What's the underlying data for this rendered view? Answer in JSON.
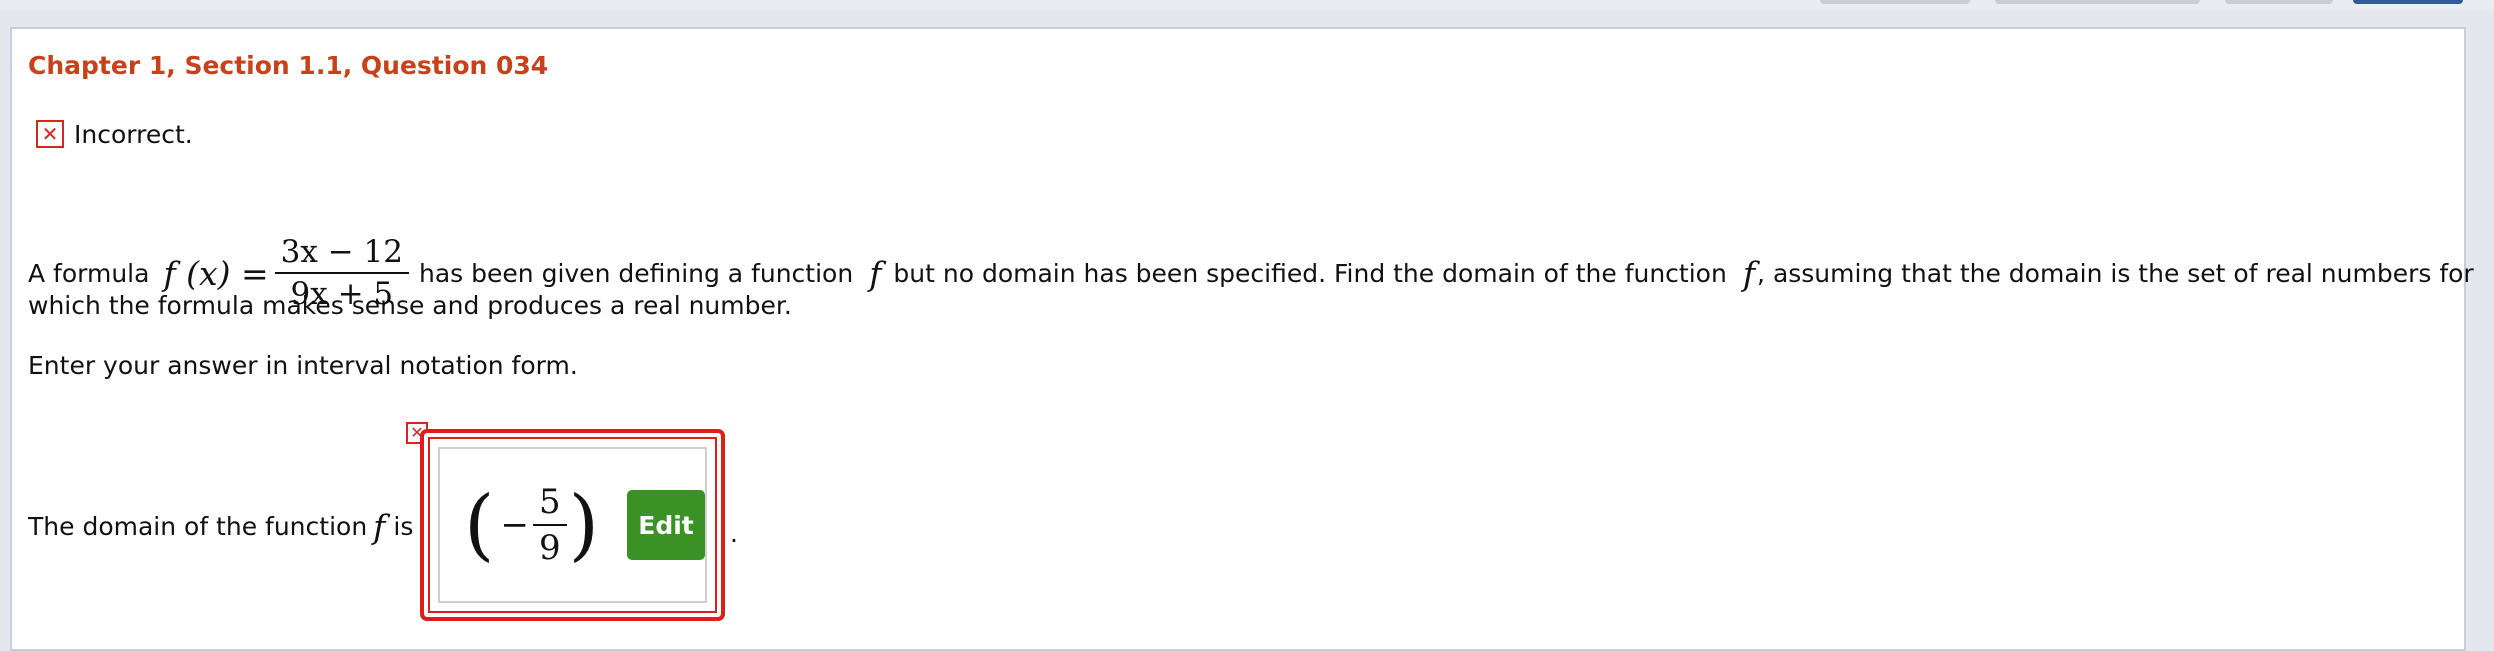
{
  "header": {
    "title": "Chapter 1, Section 1.1, Question 034"
  },
  "feedback": {
    "icon": "x-mark-icon",
    "status_text": "Incorrect."
  },
  "question": {
    "intro": "A formula",
    "function_lhs": "f (x) =",
    "numerator": "3x − 12",
    "denominator": "9x + 5",
    "text_middle": "has been given defining a function",
    "f_symbol": "f",
    "text_after_f": "but no domain has been specified. Find the domain of the function",
    "f_symbol2": "f",
    "text_end": ", assuming that the domain is the set of real numbers for",
    "line2": "which the formula makes sense and produces a real number.",
    "instructions": "Enter your answer in interval notation form."
  },
  "answer": {
    "label_prefix": "The domain of the function",
    "label_f": "f",
    "label_suffix": "is",
    "left_paren": "(",
    "sign": "−",
    "numerator": "5",
    "denominator": "9",
    "right_paren": ")",
    "edit_label": "Edit",
    "period": ".",
    "error_icon": "x-mark-icon"
  },
  "colors": {
    "title": "#c7421a",
    "error": "#e01e18",
    "edit_button": "#3b9224"
  }
}
